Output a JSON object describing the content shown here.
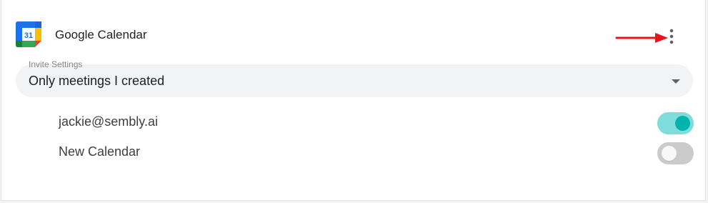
{
  "integration": {
    "title": "Google Calendar",
    "logo_icon": "google-calendar-icon",
    "logo_day": "31",
    "more_icon": "more-vertical-icon"
  },
  "invite_settings": {
    "label": "Invite Settings",
    "value": "Only meetings I created",
    "caret_icon": "caret-down-icon"
  },
  "calendars": [
    {
      "name": "jackie@sembly.ai",
      "enabled": true
    },
    {
      "name": "New Calendar",
      "enabled": false
    }
  ],
  "colors": {
    "toggle_on_track": "#7fdcdc",
    "toggle_on_knob": "#00b3ad",
    "toggle_off_track": "#cbcbcb",
    "annotation_arrow": "#e8141c"
  }
}
